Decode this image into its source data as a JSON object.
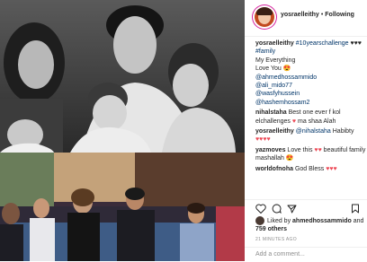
{
  "post": {
    "username": "yosraelleithy",
    "follow_label": "Following",
    "caption": {
      "user": "yosraelleithy",
      "hashtag1": "#10yearschallenge",
      "hashtag2": "#family",
      "line1": "My Everything",
      "line2": "Love You",
      "mentions": [
        "@ahmedhossammido",
        "@ali_mido77",
        "@wasfyhussein",
        "@hashemhossam2"
      ]
    },
    "comments": [
      {
        "user": "nihalstaha",
        "text": "Best one ever f kol elchallenges",
        "text2": "ma shaa Alah"
      },
      {
        "user": "yosraelleithy",
        "mention": "@nihalstaha",
        "text": "Habibty"
      },
      {
        "user": "yazmoves",
        "text": "Love this",
        "text2": "beautiful family mashallah"
      },
      {
        "user": "worldofnoha",
        "text": "God Bless"
      }
    ],
    "likes": {
      "prefix": "Liked by",
      "user": "ahmedhossammido",
      "and": "and",
      "count": "759 others"
    },
    "timestamp": "21 MINUTES AGO",
    "add_comment_placeholder": "Add a comment..."
  },
  "colors": {
    "link": "#003569",
    "heart": "#ed4956",
    "muted": "#8e8e8e"
  },
  "icons": [
    "heart-icon",
    "comment-icon",
    "share-icon",
    "bookmark-icon"
  ]
}
